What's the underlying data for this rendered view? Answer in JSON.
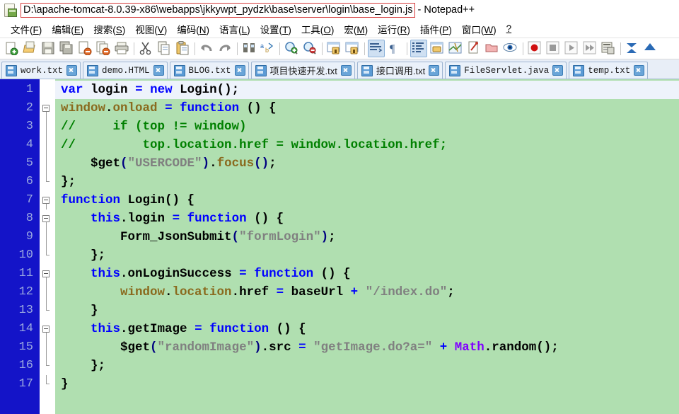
{
  "window": {
    "icon": "notepadpp-icon",
    "path": "D:\\apache-tomcat-8.0.39-x86\\webapps\\jkkywpt_pydzk\\base\\server\\login\\base_login.js",
    "suffix": "- Notepad++",
    "path_highlight_color": "#d63b3b"
  },
  "menu": {
    "items": [
      {
        "label": "文件(F)",
        "text": "文件(",
        "mnemonic": "F",
        "tail": ")"
      },
      {
        "label": "编辑(E)",
        "text": "编辑(",
        "mnemonic": "E",
        "tail": ")"
      },
      {
        "label": "搜索(S)",
        "text": "搜索(",
        "mnemonic": "S",
        "tail": ")"
      },
      {
        "label": "视图(V)",
        "text": "视图(",
        "mnemonic": "V",
        "tail": ")"
      },
      {
        "label": "编码(N)",
        "text": "编码(",
        "mnemonic": "N",
        "tail": ")"
      },
      {
        "label": "语言(L)",
        "text": "语言(",
        "mnemonic": "L",
        "tail": ")"
      },
      {
        "label": "设置(T)",
        "text": "设置(",
        "mnemonic": "T",
        "tail": ")"
      },
      {
        "label": "工具(O)",
        "text": "工具(",
        "mnemonic": "O",
        "tail": ")"
      },
      {
        "label": "宏(M)",
        "text": "宏(",
        "mnemonic": "M",
        "tail": ")"
      },
      {
        "label": "运行(R)",
        "text": "运行(",
        "mnemonic": "R",
        "tail": ")"
      },
      {
        "label": "插件(P)",
        "text": "插件(",
        "mnemonic": "P",
        "tail": ")"
      },
      {
        "label": "窗口(W)",
        "text": "窗口(",
        "mnemonic": "W",
        "tail": ")"
      },
      {
        "label": "?",
        "text": "?",
        "mnemonic": "",
        "tail": ""
      }
    ]
  },
  "toolbar": {
    "buttons": [
      {
        "name": "new-file-icon",
        "title": "新建"
      },
      {
        "name": "open-file-icon",
        "title": "打开"
      },
      {
        "name": "save-icon",
        "title": "保存"
      },
      {
        "name": "save-all-icon",
        "title": "保存所有"
      },
      {
        "name": "close-file-icon",
        "title": "关闭"
      },
      {
        "name": "close-all-icon",
        "title": "关闭所有"
      },
      {
        "name": "print-icon",
        "title": "打印"
      },
      {
        "name": "separator",
        "title": ""
      },
      {
        "name": "cut-icon",
        "title": "剪切"
      },
      {
        "name": "copy-icon",
        "title": "复制"
      },
      {
        "name": "paste-icon",
        "title": "粘贴"
      },
      {
        "name": "separator",
        "title": ""
      },
      {
        "name": "undo-icon",
        "title": "撤销"
      },
      {
        "name": "redo-icon",
        "title": "重做"
      },
      {
        "name": "separator",
        "title": ""
      },
      {
        "name": "find-icon",
        "title": "查找"
      },
      {
        "name": "replace-icon",
        "title": "替换"
      },
      {
        "name": "separator",
        "title": ""
      },
      {
        "name": "zoom-in-icon",
        "title": "放大"
      },
      {
        "name": "zoom-out-icon",
        "title": "缩小"
      },
      {
        "name": "separator",
        "title": ""
      },
      {
        "name": "sync-vertical-icon",
        "title": "垂直同步滚动"
      },
      {
        "name": "sync-horizontal-icon",
        "title": "水平同步滚动"
      },
      {
        "name": "separator",
        "title": ""
      },
      {
        "name": "word-wrap-icon",
        "title": "自动换行"
      },
      {
        "name": "show-pilcrow-icon",
        "title": "显示所有字符"
      },
      {
        "name": "separator",
        "title": ""
      },
      {
        "name": "indent-guide-icon",
        "title": "显示缩进参考线"
      },
      {
        "name": "user-define-dialog-icon",
        "title": "用户自定义语言"
      },
      {
        "name": "doc-map-icon",
        "title": "文档地图"
      },
      {
        "name": "function-list-icon",
        "title": "函数列表"
      },
      {
        "name": "folder-as-workspace-icon",
        "title": "文件夹作为工作区"
      },
      {
        "name": "monitoring-icon",
        "title": "监视文件"
      },
      {
        "name": "separator",
        "title": ""
      },
      {
        "name": "macro-record-icon",
        "title": "开始录制宏"
      },
      {
        "name": "macro-stop-icon",
        "title": "停止录制宏"
      },
      {
        "name": "macro-play-icon",
        "title": "回放宏"
      },
      {
        "name": "macro-play-multiple-icon",
        "title": "多次运行宏"
      },
      {
        "name": "macro-save-icon",
        "title": "保存当前录制的宏"
      },
      {
        "name": "separator",
        "title": ""
      },
      {
        "name": "collapse-all-icon",
        "title": "全部折叠"
      },
      {
        "name": "expand-all-icon",
        "title": "全部展开"
      }
    ]
  },
  "tabs": [
    {
      "label": "work.txt",
      "cjk": false,
      "active": false
    },
    {
      "label": "demo.HTML",
      "cjk": false,
      "active": false
    },
    {
      "label": "BLOG.txt",
      "cjk": false,
      "active": false
    },
    {
      "label": "项目快速开发.txt",
      "cjk": true,
      "active": false
    },
    {
      "label": "接口调用.txt",
      "cjk": true,
      "active": false
    },
    {
      "label": "FileServlet.java",
      "cjk": false,
      "active": false
    },
    {
      "label": "temp.txt",
      "cjk": false,
      "active": false
    }
  ],
  "editor": {
    "gutter_bg": "#1414c8",
    "gutter_fg": "#9aa8e0",
    "code_bg": "#b0dfb0",
    "current_line_bg": "#eef3fb",
    "line_numbers": [
      "1",
      "2",
      "3",
      "4",
      "5",
      "6",
      "7",
      "8",
      "9",
      "10",
      "11",
      "12",
      "13",
      "14",
      "15",
      "16",
      "17"
    ],
    "lines": [
      {
        "n": 1,
        "current": true,
        "fold": "none",
        "tokens": [
          {
            "t": "var",
            "c": "t-kw"
          },
          {
            "t": " ",
            "c": "t-ident"
          },
          {
            "t": "login",
            "c": "t-ident"
          },
          {
            "t": " ",
            "c": "t-ident"
          },
          {
            "t": "=",
            "c": "t-op"
          },
          {
            "t": " ",
            "c": "t-ident"
          },
          {
            "t": "new",
            "c": "t-kw"
          },
          {
            "t": " ",
            "c": "t-ident"
          },
          {
            "t": "Login();",
            "c": "t-ident"
          }
        ]
      },
      {
        "n": 2,
        "current": false,
        "fold": "open",
        "tokens": [
          {
            "t": "window",
            "c": "t-obj"
          },
          {
            "t": ".",
            "c": "t-ident"
          },
          {
            "t": "onload",
            "c": "t-obj"
          },
          {
            "t": " ",
            "c": "t-ident"
          },
          {
            "t": "=",
            "c": "t-op"
          },
          {
            "t": " ",
            "c": "t-ident"
          },
          {
            "t": "function",
            "c": "t-kw"
          },
          {
            "t": " () {",
            "c": "t-ident"
          }
        ]
      },
      {
        "n": 3,
        "current": false,
        "fold": "line",
        "tokens": [
          {
            "t": "//     if (top != window)",
            "c": "t-cmt"
          }
        ]
      },
      {
        "n": 4,
        "current": false,
        "fold": "line",
        "tokens": [
          {
            "t": "//         top.location.href = window.location.href;",
            "c": "t-cmt"
          }
        ]
      },
      {
        "n": 5,
        "current": false,
        "fold": "line",
        "tokens": [
          {
            "t": "    ",
            "c": "t-ident"
          },
          {
            "t": "$get",
            "c": "t-ident"
          },
          {
            "t": "(",
            "c": "t-punc"
          },
          {
            "t": "\"USERCODE\"",
            "c": "t-str"
          },
          {
            "t": ")",
            "c": "t-punc"
          },
          {
            "t": ".",
            "c": "t-ident"
          },
          {
            "t": "focus",
            "c": "t-obj"
          },
          {
            "t": "(",
            "c": "t-punc"
          },
          {
            "t": ")",
            "c": "t-punc"
          },
          {
            "t": ";",
            "c": "t-ident"
          }
        ]
      },
      {
        "n": 6,
        "current": false,
        "fold": "end",
        "tokens": [
          {
            "t": "};",
            "c": "t-ident"
          }
        ]
      },
      {
        "n": 7,
        "current": false,
        "fold": "open",
        "tokens": [
          {
            "t": "function",
            "c": "t-kw"
          },
          {
            "t": " ",
            "c": "t-ident"
          },
          {
            "t": "Login() {",
            "c": "t-ident"
          }
        ]
      },
      {
        "n": 8,
        "current": false,
        "fold": "open-indent",
        "tokens": [
          {
            "t": "    ",
            "c": "t-ident"
          },
          {
            "t": "this",
            "c": "t-this"
          },
          {
            "t": ".",
            "c": "t-ident"
          },
          {
            "t": "login",
            "c": "t-ident"
          },
          {
            "t": " ",
            "c": "t-ident"
          },
          {
            "t": "=",
            "c": "t-op"
          },
          {
            "t": " ",
            "c": "t-ident"
          },
          {
            "t": "function",
            "c": "t-kw"
          },
          {
            "t": " () {",
            "c": "t-ident"
          }
        ]
      },
      {
        "n": 9,
        "current": false,
        "fold": "line",
        "tokens": [
          {
            "t": "        ",
            "c": "t-ident"
          },
          {
            "t": "Form_JsonSubmit",
            "c": "t-ident"
          },
          {
            "t": "(",
            "c": "t-punc"
          },
          {
            "t": "\"formLogin\"",
            "c": "t-str"
          },
          {
            "t": ")",
            "c": "t-punc"
          },
          {
            "t": ";",
            "c": "t-ident"
          }
        ]
      },
      {
        "n": 10,
        "current": false,
        "fold": "end-indent",
        "tokens": [
          {
            "t": "    };",
            "c": "t-ident"
          }
        ]
      },
      {
        "n": 11,
        "current": false,
        "fold": "open-indent",
        "tokens": [
          {
            "t": "    ",
            "c": "t-ident"
          },
          {
            "t": "this",
            "c": "t-this"
          },
          {
            "t": ".",
            "c": "t-ident"
          },
          {
            "t": "onLoginSuccess",
            "c": "t-ident"
          },
          {
            "t": " ",
            "c": "t-ident"
          },
          {
            "t": "=",
            "c": "t-op"
          },
          {
            "t": " ",
            "c": "t-ident"
          },
          {
            "t": "function",
            "c": "t-kw"
          },
          {
            "t": " () {",
            "c": "t-ident"
          }
        ]
      },
      {
        "n": 12,
        "current": false,
        "fold": "line",
        "tokens": [
          {
            "t": "        ",
            "c": "t-ident"
          },
          {
            "t": "window",
            "c": "t-obj"
          },
          {
            "t": ".",
            "c": "t-ident"
          },
          {
            "t": "location",
            "c": "t-obj"
          },
          {
            "t": ".",
            "c": "t-ident"
          },
          {
            "t": "href",
            "c": "t-ident"
          },
          {
            "t": " ",
            "c": "t-ident"
          },
          {
            "t": "=",
            "c": "t-op"
          },
          {
            "t": " ",
            "c": "t-ident"
          },
          {
            "t": "baseUrl",
            "c": "t-ident"
          },
          {
            "t": " ",
            "c": "t-ident"
          },
          {
            "t": "+",
            "c": "t-op"
          },
          {
            "t": " ",
            "c": "t-ident"
          },
          {
            "t": "\"/index.do\"",
            "c": "t-str"
          },
          {
            "t": ";",
            "c": "t-ident"
          }
        ]
      },
      {
        "n": 13,
        "current": false,
        "fold": "end-indent",
        "tokens": [
          {
            "t": "    }",
            "c": "t-ident"
          }
        ]
      },
      {
        "n": 14,
        "current": false,
        "fold": "open-indent",
        "tokens": [
          {
            "t": "    ",
            "c": "t-ident"
          },
          {
            "t": "this",
            "c": "t-this"
          },
          {
            "t": ".",
            "c": "t-ident"
          },
          {
            "t": "getImage",
            "c": "t-ident"
          },
          {
            "t": " ",
            "c": "t-ident"
          },
          {
            "t": "=",
            "c": "t-op"
          },
          {
            "t": " ",
            "c": "t-ident"
          },
          {
            "t": "function",
            "c": "t-kw"
          },
          {
            "t": " () {",
            "c": "t-ident"
          }
        ]
      },
      {
        "n": 15,
        "current": false,
        "fold": "line",
        "tokens": [
          {
            "t": "        ",
            "c": "t-ident"
          },
          {
            "t": "$get",
            "c": "t-ident"
          },
          {
            "t": "(",
            "c": "t-punc"
          },
          {
            "t": "\"randomImage\"",
            "c": "t-str"
          },
          {
            "t": ")",
            "c": "t-punc"
          },
          {
            "t": ".",
            "c": "t-ident"
          },
          {
            "t": "src",
            "c": "t-ident"
          },
          {
            "t": " ",
            "c": "t-ident"
          },
          {
            "t": "=",
            "c": "t-op"
          },
          {
            "t": " ",
            "c": "t-ident"
          },
          {
            "t": "\"getImage.do?a=\"",
            "c": "t-str"
          },
          {
            "t": " ",
            "c": "t-ident"
          },
          {
            "t": "+",
            "c": "t-op"
          },
          {
            "t": " ",
            "c": "t-ident"
          },
          {
            "t": "Math",
            "c": "t-cls"
          },
          {
            "t": ".",
            "c": "t-ident"
          },
          {
            "t": "random();",
            "c": "t-ident"
          }
        ]
      },
      {
        "n": 16,
        "current": false,
        "fold": "end-indent",
        "tokens": [
          {
            "t": "    };",
            "c": "t-ident"
          }
        ]
      },
      {
        "n": 17,
        "current": false,
        "fold": "end",
        "tokens": [
          {
            "t": "}",
            "c": "t-ident"
          }
        ]
      }
    ]
  }
}
